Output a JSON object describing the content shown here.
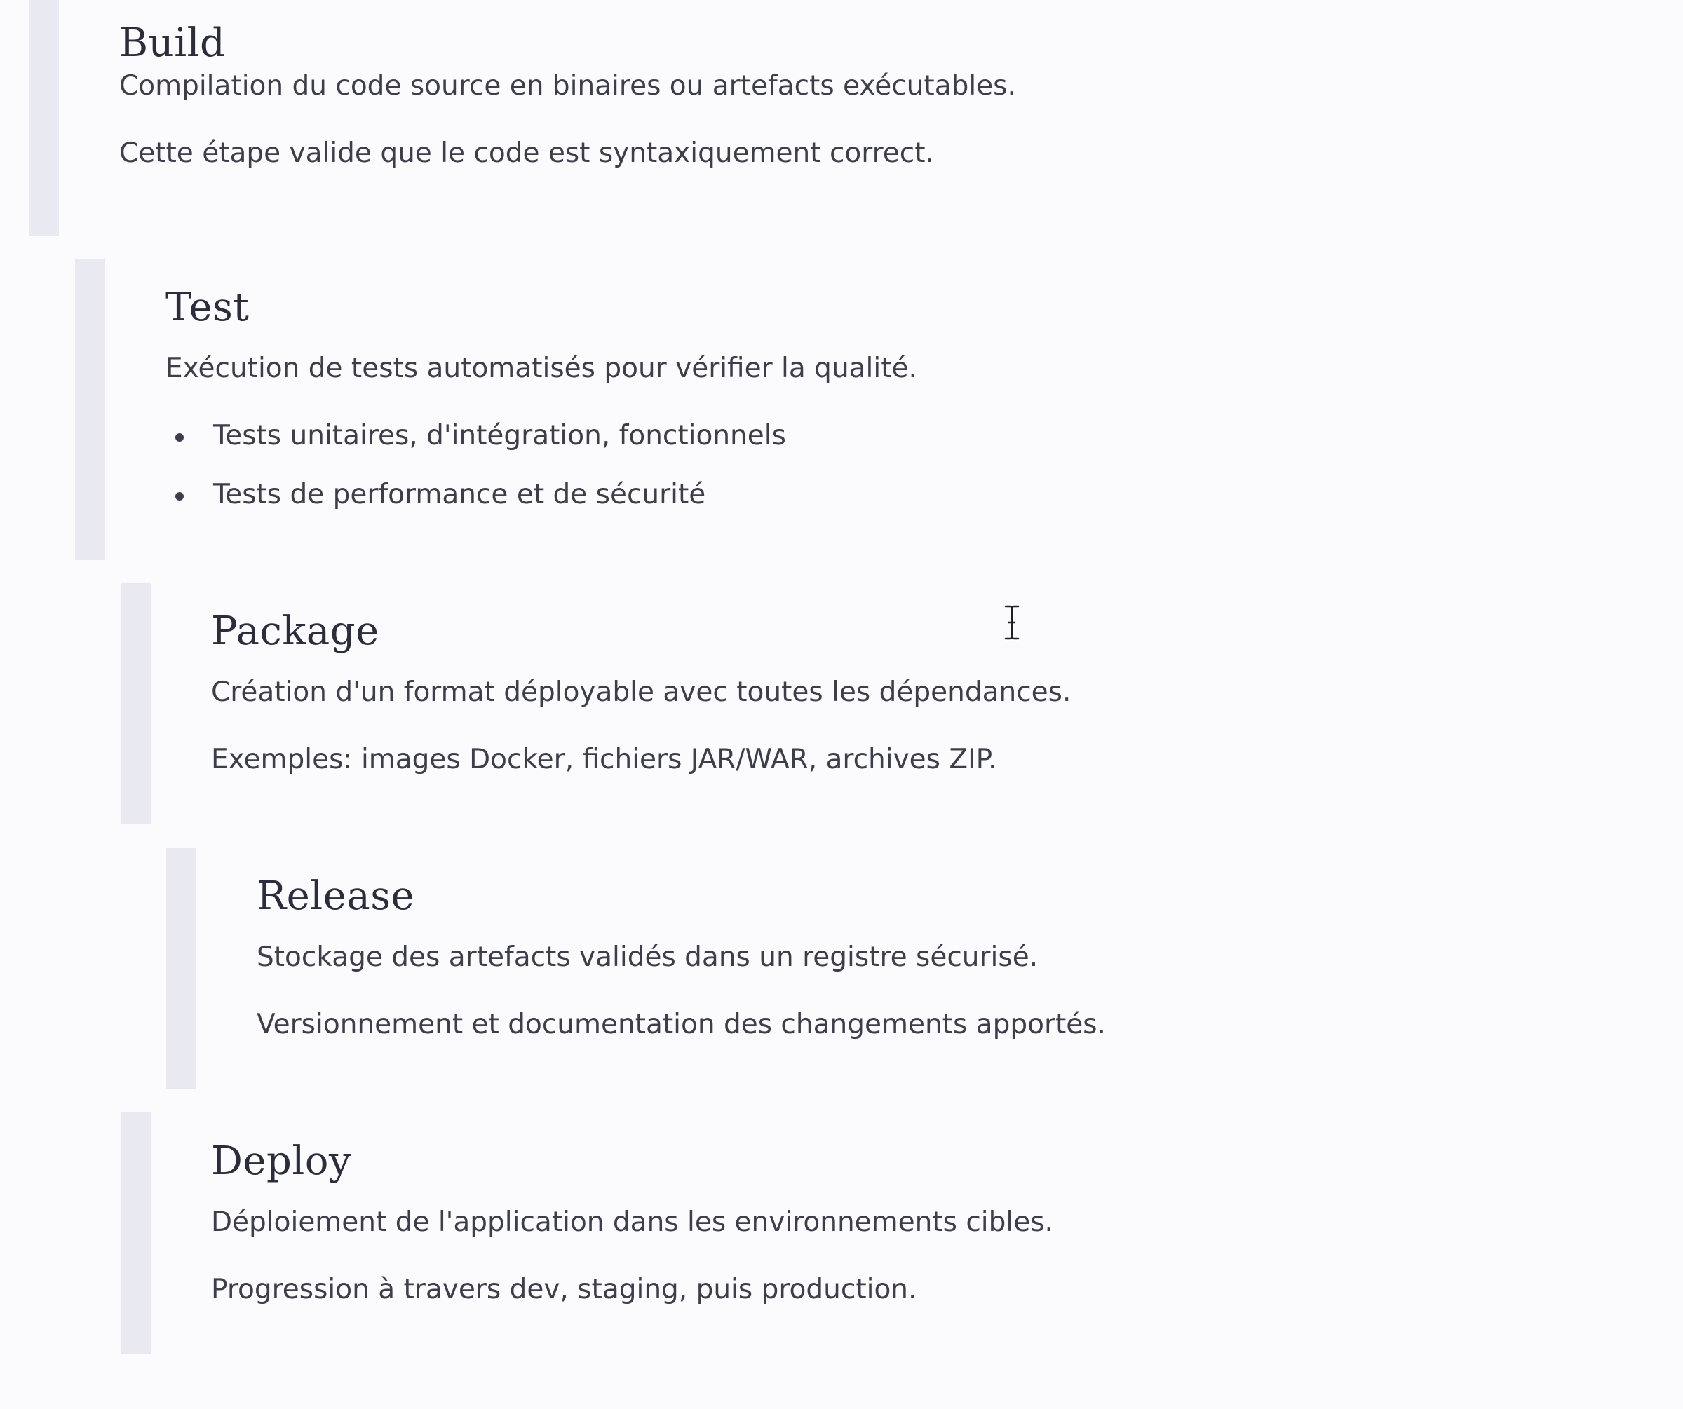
{
  "stages": {
    "build": {
      "title": "Build",
      "lines": [
        "Compilation du code source en binaires ou artefacts exécutables.",
        "Cette étape valide que le code est syntaxiquement correct."
      ]
    },
    "test": {
      "title": "Test",
      "description": "Exécution de tests automatisés pour vérifier la qualité.",
      "bullets": [
        "Tests unitaires, d'intégration, fonctionnels",
        "Tests de performance et de sécurité"
      ]
    },
    "package": {
      "title": "Package",
      "lines": [
        "Création d'un format déployable avec toutes les dépendances.",
        "Exemples: images Docker, fichiers JAR/WAR, archives ZIP."
      ]
    },
    "release": {
      "title": "Release",
      "lines": [
        "Stockage des artefacts validés dans un registre sécurisé.",
        "Versionnement et documentation des changements apportés."
      ]
    },
    "deploy": {
      "title": "Deploy",
      "lines": [
        "Déploiement de l'application dans les environnements cibles.",
        "Progression à travers dev, staging, puis production."
      ]
    }
  },
  "colors": {
    "background": "#fbfbfd",
    "border": "#e9e9f1",
    "heading": "#2c2d3a",
    "text": "#3d3e4a"
  },
  "icons": {
    "cursor": "text-cursor-icon"
  }
}
